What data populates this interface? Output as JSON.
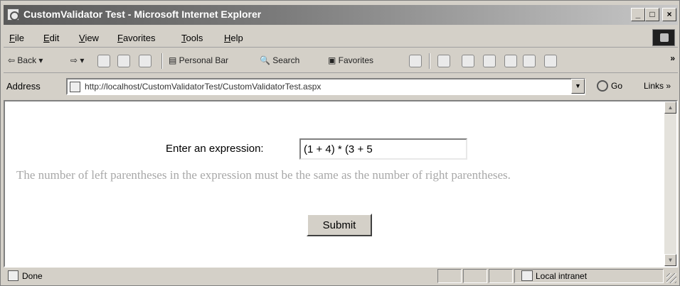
{
  "window": {
    "title": "CustomValidator Test - Microsoft Internet Explorer",
    "controls": {
      "minimize": "_",
      "maximize": "□",
      "close": "×"
    }
  },
  "menu": [
    "File",
    "Edit",
    "View",
    "Favorites",
    "Tools",
    "Help"
  ],
  "toolbar": {
    "back": "Back",
    "search": "Search",
    "favorites": "Favorites",
    "personal_bar": "Personal Bar",
    "more": "»"
  },
  "address": {
    "label": "Address",
    "url": "http://localhost/CustomValidatorTest/CustomValidatorTest.aspx",
    "go": "Go",
    "links": "Links »"
  },
  "page": {
    "prompt": "Enter an expression:",
    "expression_value": "(1 + 4) * (3 + 5",
    "error_message": "The number of left parentheses in the expression must be the same as the number of right parentheses.",
    "submit": "Submit"
  },
  "status": {
    "text": "Done",
    "zone": "Local intranet"
  },
  "colors": {
    "chrome": "#d4d0c8",
    "error_text": "#a8a8a8",
    "title_bar": "#5a5a5a"
  }
}
